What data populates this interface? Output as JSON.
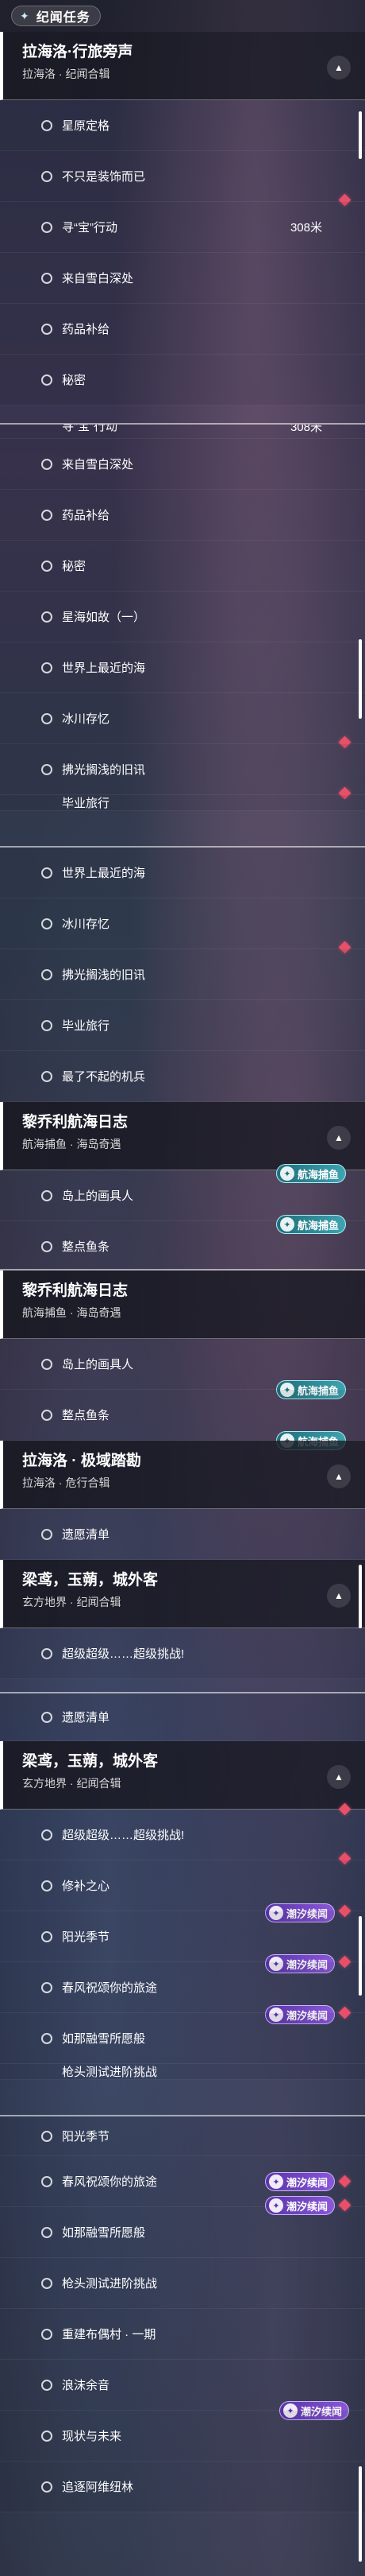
{
  "title": "纪闻任务",
  "distance": "308米",
  "badges": {
    "chaoxi": "潮汐续闻",
    "hanghai": "航海捕鱼"
  },
  "groups": {
    "lahailuo_xinglv": {
      "title": "拉海洛·行旅旁声",
      "sub": "拉海洛 · 纪闻合辑"
    },
    "liqiaoli": {
      "title": "黎乔利航海日志",
      "sub": "航海捕鱼 · 海岛奇遇"
    },
    "lahailuo_jiyu": {
      "title": "拉海洛 · 极域踏勘",
      "sub": "拉海洛 · 危行合辑"
    },
    "liangniao": {
      "title": "梁鸢，玉蒴，城外客",
      "sub": "玄方地界 · 纪闻合辑"
    }
  },
  "quests": {
    "xingyuan": "星原定格",
    "buzhishi": "不只是装饰而已",
    "xunbao": "寻“宝”行动",
    "laizixuebai": "来自雪白深处",
    "yaopin": "药品补给",
    "mimi": "秘密",
    "xinghai": "星海如故（一）",
    "zuijin": "世界上最近的海",
    "bingchuan": "冰川存忆",
    "fuguang": "拂光搁浅的旧讯",
    "biye": "毕业旅行",
    "liaobuqi": "最了不起的机兵",
    "daoshang": "岛上的画具人",
    "zhengdian": "整点鱼条",
    "yizhi": "遗愿清单",
    "chaoji": "超级超级……超级挑战!",
    "xiubu": "修补之心",
    "yangguang": "阳光季节",
    "chunfeng": "春风祝颂你的旅途",
    "runaxue": "如那融雪所愿般",
    "qiangtou": "枪头测试进阶挑战",
    "chongjian": "重建布偶村 · 一期",
    "liangfeng": "浪沫余音",
    "xianzhuang": "现状与未来",
    "zhuiyuan": "追逐阿维纽林"
  },
  "colors": {
    "accent_red": "#e8506a",
    "purple": "#8a57d8",
    "teal": "#3fa3b0"
  }
}
